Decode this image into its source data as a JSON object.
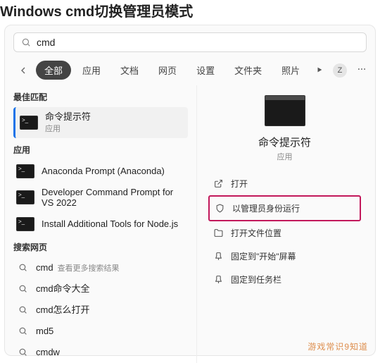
{
  "page_header": "Windows cmd切换管理员模式",
  "search": {
    "value": "cmd"
  },
  "tabs": [
    "全部",
    "应用",
    "文档",
    "网页",
    "设置",
    "文件夹",
    "照片"
  ],
  "active_tab_index": 0,
  "avatar_letter": "Z",
  "sections": {
    "best_match": "最佳匹配",
    "apps": "应用",
    "web": "搜索网页",
    "see_more": "查看更多搜索结果"
  },
  "best_match": {
    "title": "命令提示符",
    "subtitle": "应用"
  },
  "apps": [
    {
      "title": "Anaconda Prompt (Anaconda)"
    },
    {
      "title": "Developer Command Prompt for VS 2022"
    },
    {
      "title": "Install Additional Tools for Node.js"
    }
  ],
  "web_results": [
    {
      "title": "cmd",
      "note": true
    },
    {
      "title": "cmd命令大全"
    },
    {
      "title": "cmd怎么打开"
    },
    {
      "title": "md5"
    },
    {
      "title": "cmdw"
    }
  ],
  "preview": {
    "title": "命令提示符",
    "subtitle": "应用",
    "actions": [
      {
        "key": "open",
        "label": "打开",
        "highlight": false
      },
      {
        "key": "run_admin",
        "label": "以管理员身份运行",
        "highlight": true
      },
      {
        "key": "open_location",
        "label": "打开文件位置",
        "highlight": false
      },
      {
        "key": "pin_start",
        "label": "固定到\"开始\"屏幕",
        "highlight": false
      },
      {
        "key": "pin_taskbar",
        "label": "固定到任务栏",
        "highlight": false
      }
    ]
  },
  "watermark": "游戏常识9知道"
}
